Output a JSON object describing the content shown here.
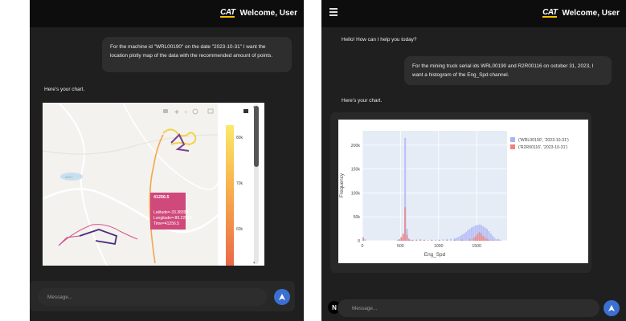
{
  "brand": {
    "logo_text": "CAT",
    "welcome": "Welcome, User",
    "brand_color": "#f5c400"
  },
  "left": {
    "user_message": "For the machine id \"WRL00190\" on the date \"2023-10-31\" I want the location plotly map of the data with the recommended amount of points.",
    "assistant_message": "Here's your chart.",
    "composer_placeholder": "Message...",
    "map": {
      "tooltip_title": "41256.5",
      "tooltip_lines": [
        "Latitude=-33.38393",
        "Longitude=-89.22525",
        "Time=41256.5"
      ],
      "colorbar_ticks": [
        "80k",
        "70k",
        "60k"
      ]
    }
  },
  "right": {
    "greeting": "Hello! How can I help you today?",
    "user_message": "For the mining truck serial ids WRL00190 and R2R00116 on october 31, 2023, I want a histogram of the Eng_Spd channel.",
    "assistant_message": "Here's your chart.",
    "composer_placeholder": "Message...",
    "avatar_letter": "N"
  },
  "chart_data": {
    "type": "bar",
    "xlabel": "Eng_Spd",
    "ylabel": "Frequency",
    "xlim": [
      0,
      1900
    ],
    "ylim": [
      0,
      230000
    ],
    "x_ticks": [
      0,
      500,
      1000,
      1500
    ],
    "y_ticks": [
      {
        "v": 0,
        "label": "0"
      },
      {
        "v": 50000,
        "label": "50k"
      },
      {
        "v": 100000,
        "label": "100k"
      },
      {
        "v": 150000,
        "label": "150k"
      },
      {
        "v": 200000,
        "label": "200k"
      }
    ],
    "bin_width": 25,
    "legend_position": "top-right",
    "series": [
      {
        "name": "('WRL00190', '2023-10-31')",
        "color": "#a9b4f4",
        "bins": [
          [
            0,
            8000
          ],
          [
            25,
            3000
          ],
          [
            450,
            2000
          ],
          [
            475,
            3000
          ],
          [
            500,
            6000
          ],
          [
            525,
            12000
          ],
          [
            550,
            215000
          ],
          [
            575,
            25000
          ],
          [
            600,
            5000
          ],
          [
            625,
            2000
          ],
          [
            650,
            1500
          ],
          [
            700,
            1500
          ],
          [
            750,
            1500
          ],
          [
            800,
            2000
          ],
          [
            850,
            1500
          ],
          [
            900,
            2000
          ],
          [
            950,
            2000
          ],
          [
            1000,
            2500
          ],
          [
            1050,
            3000
          ],
          [
            1100,
            3500
          ],
          [
            1150,
            4000
          ],
          [
            1200,
            5000
          ],
          [
            1225,
            6000
          ],
          [
            1250,
            8000
          ],
          [
            1275,
            10000
          ],
          [
            1300,
            13000
          ],
          [
            1325,
            15000
          ],
          [
            1350,
            18000
          ],
          [
            1375,
            22000
          ],
          [
            1400,
            25000
          ],
          [
            1425,
            28000
          ],
          [
            1450,
            30000
          ],
          [
            1475,
            32000
          ],
          [
            1500,
            33000
          ],
          [
            1525,
            34000
          ],
          [
            1550,
            33000
          ],
          [
            1575,
            30000
          ],
          [
            1600,
            28000
          ],
          [
            1625,
            25000
          ],
          [
            1650,
            20000
          ],
          [
            1675,
            15000
          ],
          [
            1700,
            10000
          ],
          [
            1725,
            6000
          ],
          [
            1750,
            3000
          ],
          [
            1775,
            4000
          ],
          [
            1800,
            2000
          ]
        ]
      },
      {
        "name": "('R2R00116', '2023-10-31')",
        "color": "#f2827b",
        "bins": [
          [
            0,
            5000
          ],
          [
            475,
            3000
          ],
          [
            500,
            8000
          ],
          [
            525,
            15000
          ],
          [
            550,
            70000
          ],
          [
            575,
            12000
          ],
          [
            600,
            3000
          ],
          [
            650,
            2000
          ],
          [
            700,
            2500
          ],
          [
            750,
            3000
          ],
          [
            800,
            2000
          ],
          [
            900,
            1500
          ],
          [
            1000,
            1500
          ],
          [
            1100,
            1500
          ],
          [
            1200,
            2000
          ],
          [
            1300,
            2500
          ],
          [
            1400,
            4000
          ],
          [
            1450,
            6000
          ],
          [
            1475,
            9000
          ],
          [
            1500,
            14000
          ],
          [
            1525,
            18000
          ],
          [
            1550,
            15000
          ],
          [
            1575,
            10000
          ],
          [
            1600,
            7000
          ],
          [
            1625,
            4000
          ],
          [
            1650,
            2500
          ],
          [
            1700,
            1500
          ]
        ]
      }
    ]
  }
}
